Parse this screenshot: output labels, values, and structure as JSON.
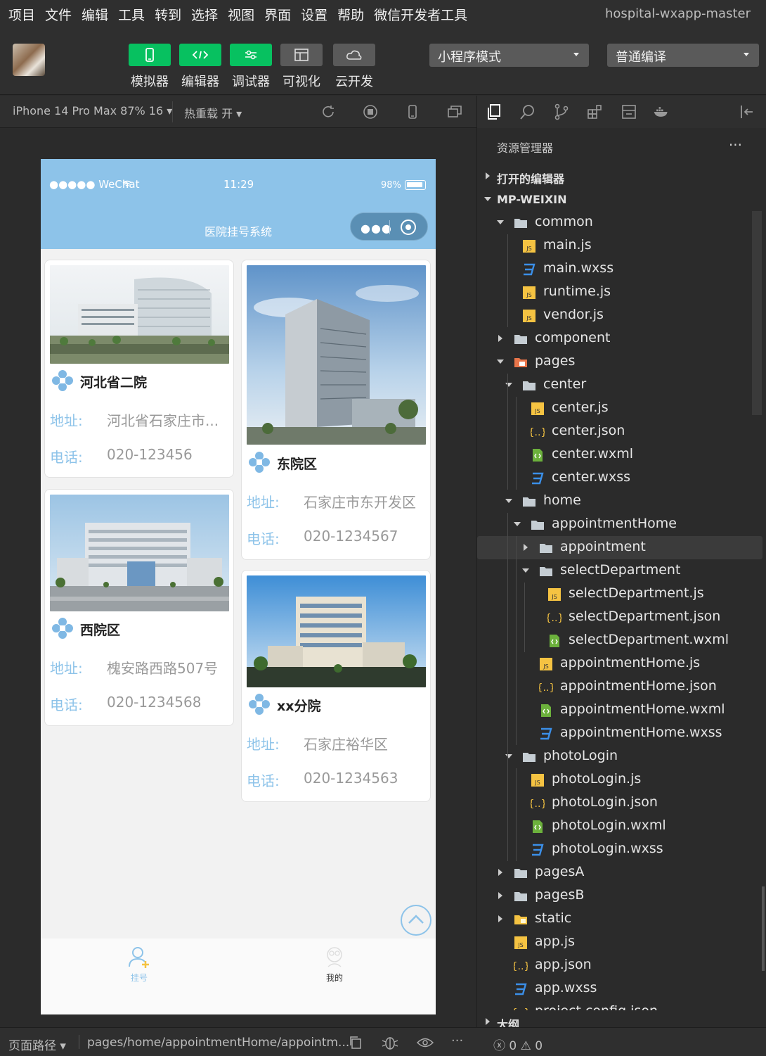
{
  "menu": [
    "项目",
    "文件",
    "编辑",
    "工具",
    "转到",
    "选择",
    "视图",
    "界面",
    "设置",
    "帮助",
    "微信开发者工具"
  ],
  "window_title": "hospital-wxapp-master",
  "toolbar": {
    "buttons": [
      {
        "label": "模拟器",
        "icon": "phone-icon"
      },
      {
        "label": "编辑器",
        "icon": "code-icon"
      },
      {
        "label": "调试器",
        "icon": "debug-icon"
      },
      {
        "label": "可视化",
        "icon": "layout-icon"
      },
      {
        "label": "云开发",
        "icon": "cloud-icon"
      }
    ],
    "mode_select": "小程序模式",
    "compile_select": "普通编译"
  },
  "simbar": {
    "device": "iPhone 14 Pro Max 87% 16 ▾",
    "hot_reload": "热重载 开 ▾"
  },
  "phone": {
    "carrier": "●●●●● WeChat",
    "time": "11:29",
    "battery": "98%",
    "nav_title": "医院挂号系统",
    "hospitals": [
      {
        "name": "河北省二院",
        "address_label": "地址:",
        "address": "河北省石家庄市...",
        "phone_label": "电话:",
        "phone": "020-123456"
      },
      {
        "name": "东院区",
        "address_label": "地址:",
        "address": "石家庄市东开发区",
        "phone_label": "电话:",
        "phone": "020-1234567"
      },
      {
        "name": "西院区",
        "address_label": "地址:",
        "address": "槐安路西路507号",
        "phone_label": "电话:",
        "phone": "020-1234568"
      },
      {
        "name": "xx分院",
        "address_label": "地址:",
        "address": "石家庄裕华区",
        "phone_label": "电话:",
        "phone": "020-1234563"
      }
    ],
    "tabs": [
      {
        "label": "挂号",
        "active": true
      },
      {
        "label": "我的",
        "active": false
      }
    ],
    "accent_color": "#8dc3e9"
  },
  "bottom": {
    "page_path_label": "页面路径 ▾",
    "page_path": "pages/home/appointmentHome/appointm...",
    "errors": "ⓧ 0 ⚠ 0"
  },
  "explorer": {
    "title": "资源管理器",
    "more": "···",
    "open_editors": "打开的编辑器",
    "root": "MP-WEIXIN",
    "outline": "大纲",
    "tree": [
      {
        "name": "common",
        "type": "folder-open"
      },
      {
        "name": "main.js",
        "type": "js"
      },
      {
        "name": "main.wxss",
        "type": "wxss"
      },
      {
        "name": "runtime.js",
        "type": "js"
      },
      {
        "name": "vendor.js",
        "type": "js"
      },
      {
        "name": "component",
        "type": "folder"
      },
      {
        "name": "pages",
        "type": "folder-open-special"
      },
      {
        "name": "center",
        "type": "folder-open"
      },
      {
        "name": "center.js",
        "type": "js"
      },
      {
        "name": "center.json",
        "type": "json"
      },
      {
        "name": "center.wxml",
        "type": "wxml"
      },
      {
        "name": "center.wxss",
        "type": "wxss"
      },
      {
        "name": "home",
        "type": "folder-open"
      },
      {
        "name": "appointmentHome",
        "type": "folder-open"
      },
      {
        "name": "appointment",
        "type": "folder"
      },
      {
        "name": "selectDepartment",
        "type": "folder-open"
      },
      {
        "name": "selectDepartment.js",
        "type": "js"
      },
      {
        "name": "selectDepartment.json",
        "type": "json"
      },
      {
        "name": "selectDepartment.wxml",
        "type": "wxml"
      },
      {
        "name": "appointmentHome.js",
        "type": "js"
      },
      {
        "name": "appointmentHome.json",
        "type": "json"
      },
      {
        "name": "appointmentHome.wxml",
        "type": "wxml"
      },
      {
        "name": "appointmentHome.wxss",
        "type": "wxss"
      },
      {
        "name": "photoLogin",
        "type": "folder-open"
      },
      {
        "name": "photoLogin.js",
        "type": "js"
      },
      {
        "name": "photoLogin.json",
        "type": "json"
      },
      {
        "name": "photoLogin.wxml",
        "type": "wxml"
      },
      {
        "name": "photoLogin.wxss",
        "type": "wxss"
      },
      {
        "name": "pagesA",
        "type": "folder"
      },
      {
        "name": "pagesB",
        "type": "folder"
      },
      {
        "name": "static",
        "type": "folder-special"
      },
      {
        "name": "app.js",
        "type": "js"
      },
      {
        "name": "app.json",
        "type": "json"
      },
      {
        "name": "app.wxss",
        "type": "wxss"
      },
      {
        "name": "project.config.json",
        "type": "json"
      }
    ]
  }
}
